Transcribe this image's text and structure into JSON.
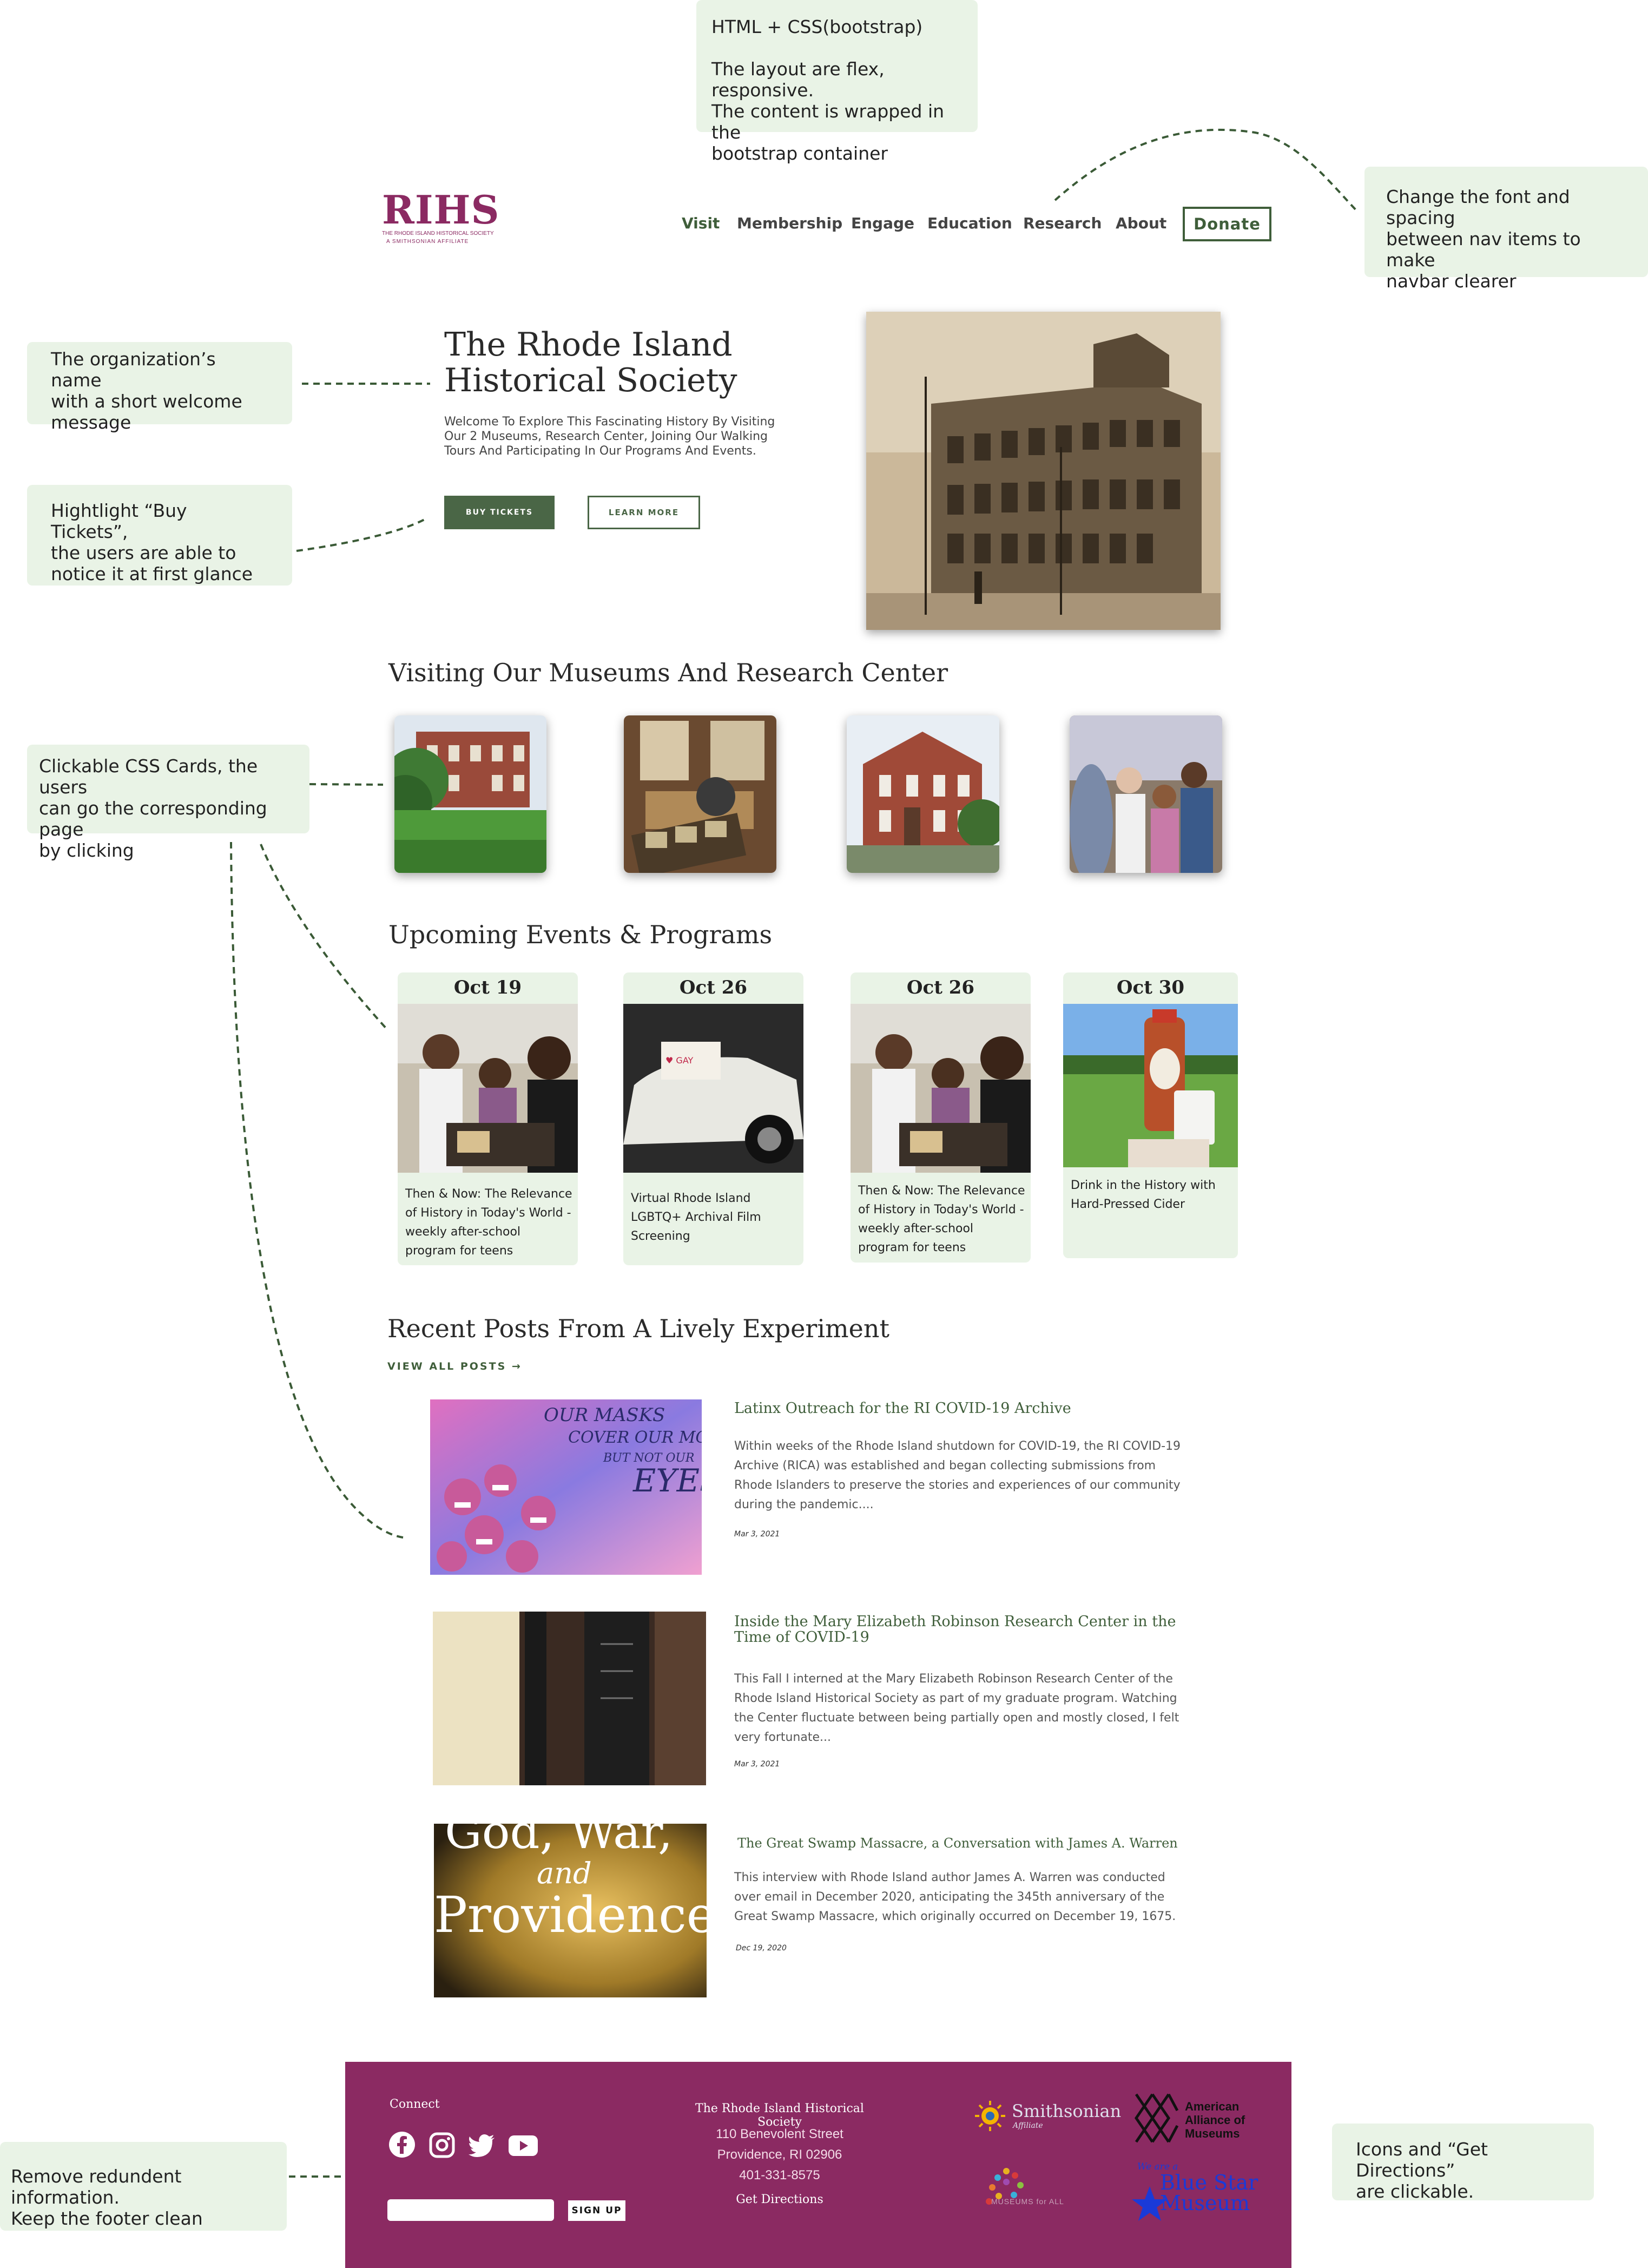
{
  "notes": {
    "tech": [
      "HTML + CSS(bootstrap)",
      "",
      "The layout are flex, responsive.",
      "The content is wrapped in the",
      "bootstrap container"
    ],
    "navbar": [
      "Change the font and spacing",
      "between nav items to make",
      "navbar clearer"
    ],
    "org_name": [
      "The organization’s name",
      "with a short welcome",
      "message"
    ],
    "tickets": [
      "Hightlight “Buy Tickets”,",
      "the users are able to",
      "notice it at first glance"
    ],
    "cards": [
      "Clickable CSS Cards, the users",
      "can go the corresponding page",
      "by clicking"
    ],
    "footer_clean": [
      "Remove redundent information.",
      "Keep the footer clean"
    ],
    "icons": [
      "Icons and “Get Directions”",
      "are clickable."
    ]
  },
  "header": {
    "logo_text": "RIHS",
    "logo_sub1": "THE RHODE ISLAND HISTORICAL SOCIETY",
    "logo_sub2": "A SMITHSONIAN AFFILIATE",
    "nav": [
      "Visit",
      "Membership",
      "Engage",
      "Education",
      "Research",
      "About"
    ],
    "donate": "Donate"
  },
  "hero": {
    "title_line1": "The Rhode Island",
    "title_line2": "Historical Society",
    "lead": [
      "Welcome To Explore This Fascinating History By Visiting",
      "Our 2 Museums, Research Center, Joining Our Walking",
      "Tours And Participating In Our Programs And Events."
    ],
    "buy": "BUY TICKETS",
    "learn": "LEARN MORE"
  },
  "museums": {
    "heading": "Visiting Our Museums And Research Center"
  },
  "events": {
    "heading": "Upcoming Events & Programs",
    "items": [
      {
        "date": "Oct 19",
        "title": "Then & Now: The Relevance of History in Today's World - weekly after-school program for teens"
      },
      {
        "date": "Oct 26",
        "title": "Virtual Rhode Island LGBTQ+ Archival Film Screening"
      },
      {
        "date": "Oct 26",
        "title": "Then & Now: The Relevance of History in Today's World - weekly after-school program for teens"
      },
      {
        "date": "Oct 30",
        "title": "Drink in the History with Hard-Pressed Cider"
      }
    ]
  },
  "posts": {
    "heading": "Recent Posts From A Lively Experiment",
    "view_all": "VIEW ALL POSTS →",
    "items": [
      {
        "title": "Latinx Outreach for the RI COVID-19 Archive",
        "body": [
          "Within weeks of the Rhode Island shutdown for COVID-19, the RI COVID-19",
          "Archive (RICA) was established and began collecting submissions from",
          "Rhode Islanders to preserve the stories and experiences of our community",
          "during the pandemic...."
        ],
        "date": "Mar 3, 2021"
      },
      {
        "title": [
          "Inside the Mary Elizabeth Robinson Research Center in the",
          "Time of COVID-19"
        ],
        "body": [
          "This Fall I interned at the Mary Elizabeth Robinson Research Center of the",
          "Rhode Island Historical Society as part of my graduate program. Watching",
          "the Center fluctuate between being partially open and mostly closed, I felt",
          "very fortunate..."
        ],
        "date": "Mar 3, 2021"
      },
      {
        "title": "The Great Swamp Massacre, a Conversation with James A. Warren",
        "body": [
          "This interview with Rhode Island author James A. Warren was conducted",
          "over email in December 2020, anticipating the 345th anniversary of the",
          "Great Swamp Massacre, which originally occurred on December 19, 1675."
        ],
        "date": "Dec 19, 2020"
      }
    ],
    "thumb1_text": [
      "OUR MASKS",
      "COVER OUR MOUTH",
      "BUT NOT OUR",
      "EYES"
    ],
    "thumb3_text": [
      "God, War,",
      "and",
      "Providence"
    ]
  },
  "footer": {
    "connect": "Connect",
    "signup": "SIGN UP",
    "org": "The Rhode Island Historical Society",
    "street": "110 Benevolent Street",
    "city": "Providence, RI 02906",
    "phone": "401-331-8575",
    "directions": "Get Directions",
    "smithsonian": "Smithsonian",
    "smithsonian_sub": "Affiliate",
    "aam": [
      "American",
      "Alliance of",
      "Museums"
    ],
    "museums_all": "MUSEUMS for ALL",
    "bluestar_top": "We are a",
    "bluestar": [
      "Blue Star",
      "Museum"
    ]
  },
  "colors": {
    "accent": "#3f5e3a",
    "brand": "#8b2a62",
    "note_bg": "#e9f3e6"
  }
}
